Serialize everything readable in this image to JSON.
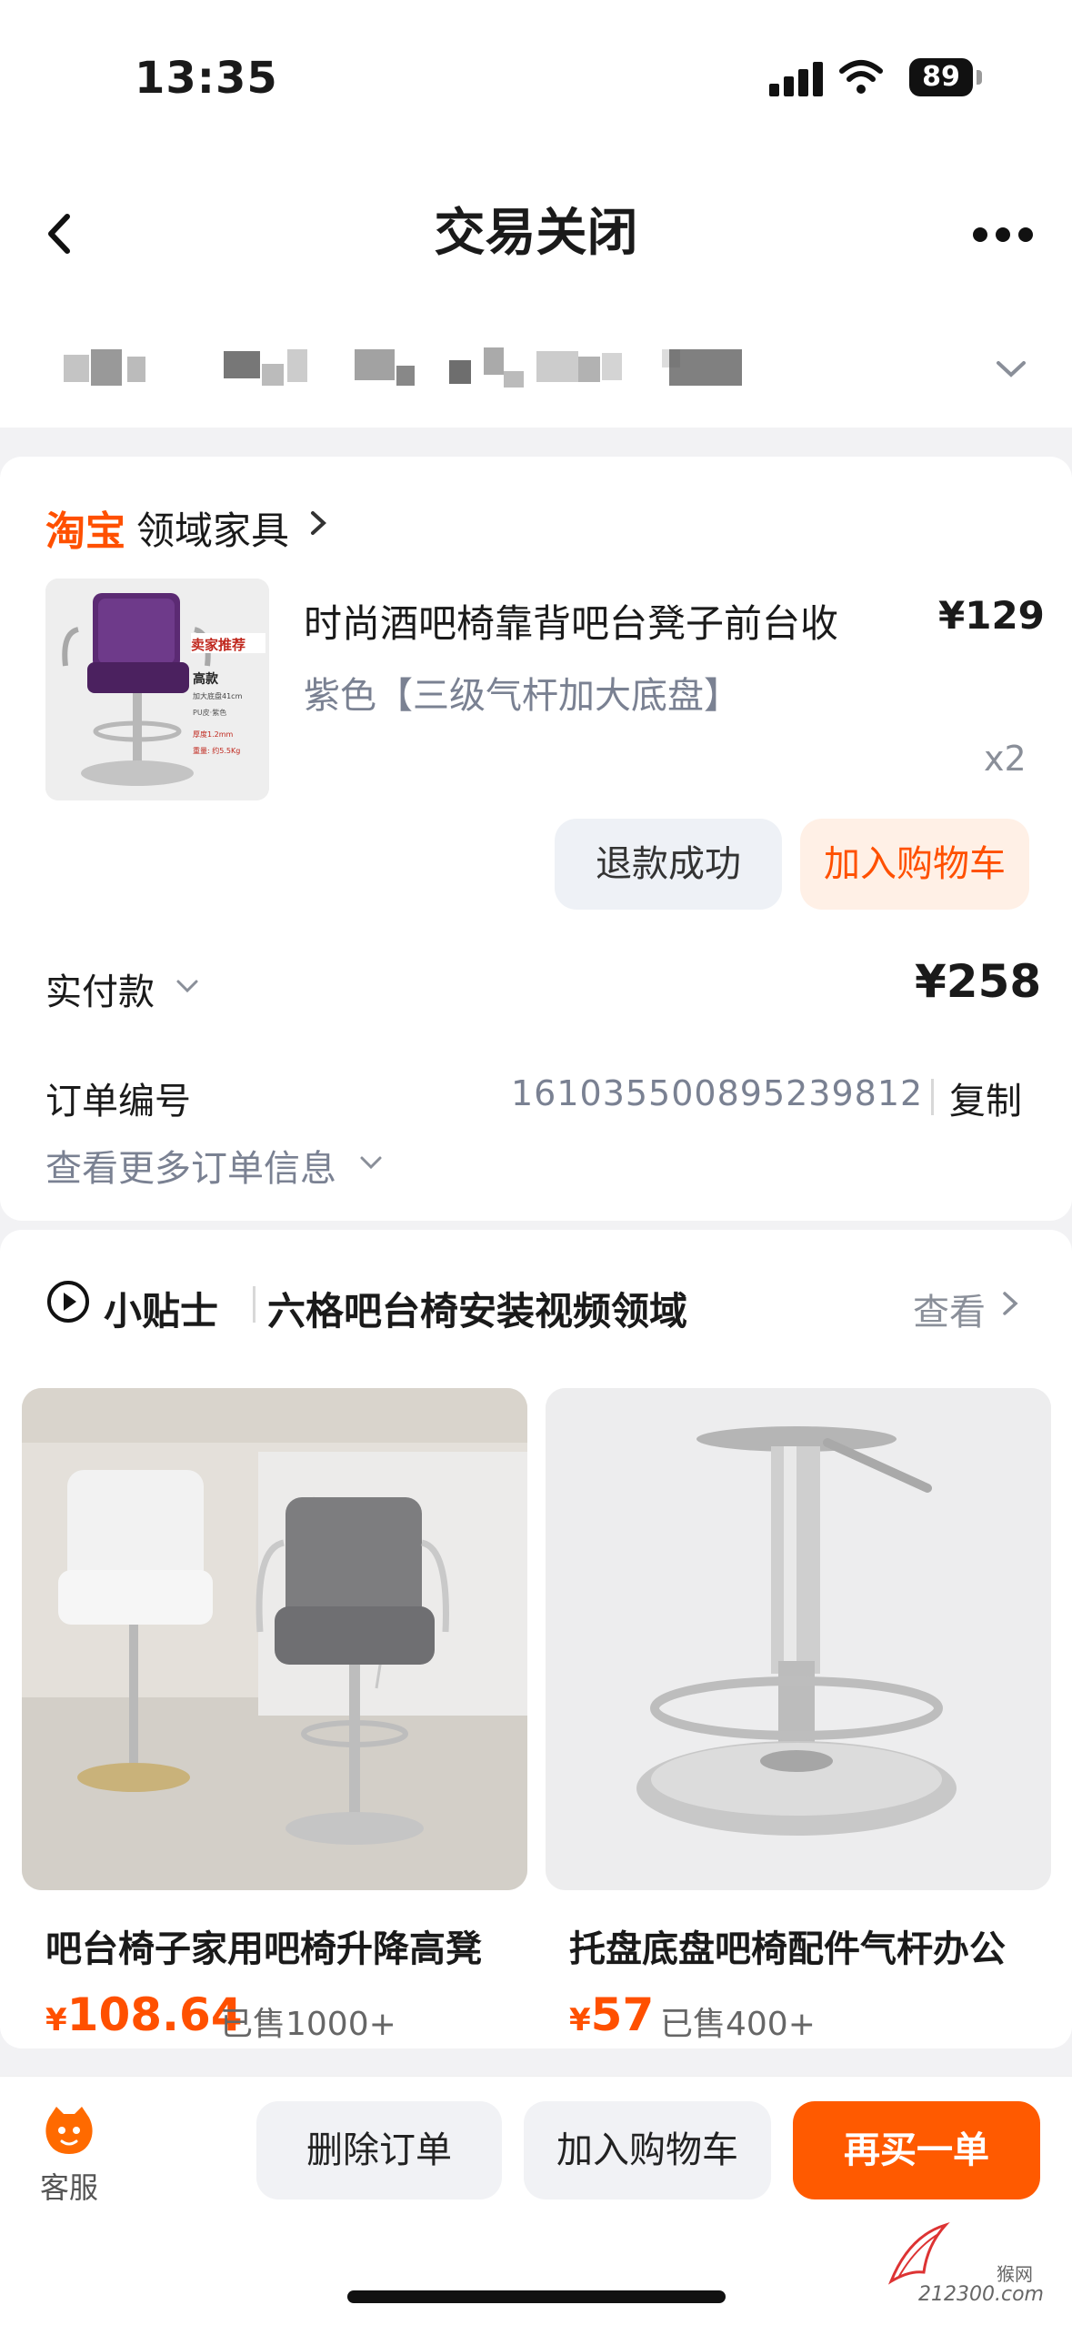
{
  "status_bar": {
    "time": "13:35",
    "battery": "89"
  },
  "nav": {
    "title": "交易关闭"
  },
  "shop": {
    "logo": "淘宝",
    "name": "领域家具"
  },
  "product": {
    "title": "时尚酒吧椅靠背吧台凳子前台收",
    "price": "¥129",
    "spec": "紫色【三级气杆加大底盘】",
    "qty": "x2",
    "image_texts": [
      "卖家推荐",
      "高款",
      "加大底盘41cm",
      "PU皮·紫色",
      "厚度1.2mm",
      "重量: 约5.5Kg"
    ]
  },
  "actions": {
    "refund_label": "退款成功",
    "add_cart_label": "加入购物车"
  },
  "payment": {
    "label": "实付款",
    "amount": "¥258"
  },
  "order": {
    "label": "订单编号",
    "number": "1610355008952398​12",
    "copy_label": "复制",
    "more_info_label": "查看更多订单信息"
  },
  "tips": {
    "label": "小贴士",
    "title": "六格吧台椅安装视频领域",
    "view_label": "查看"
  },
  "recommendations": [
    {
      "title": "吧台椅子家用吧椅升降高凳",
      "currency": "¥",
      "price": "108.64",
      "sold": "已售1000+"
    },
    {
      "title": "托盘底盘吧椅配件气杆办公",
      "currency": "¥",
      "price": "57",
      "sold": "已售400+"
    }
  ],
  "bottom_bar": {
    "service_label": "客服",
    "delete_label": "删除订单",
    "add_cart_label": "加入购物车",
    "buy_again_label": "再买一单"
  },
  "watermark": {
    "top": "猴网",
    "url": "212300.com"
  },
  "colors": {
    "accent": "#ff5000",
    "buy_button": "#ff5a00",
    "muted_text": "#7a8192",
    "page_bg": "#f2f2f4"
  }
}
